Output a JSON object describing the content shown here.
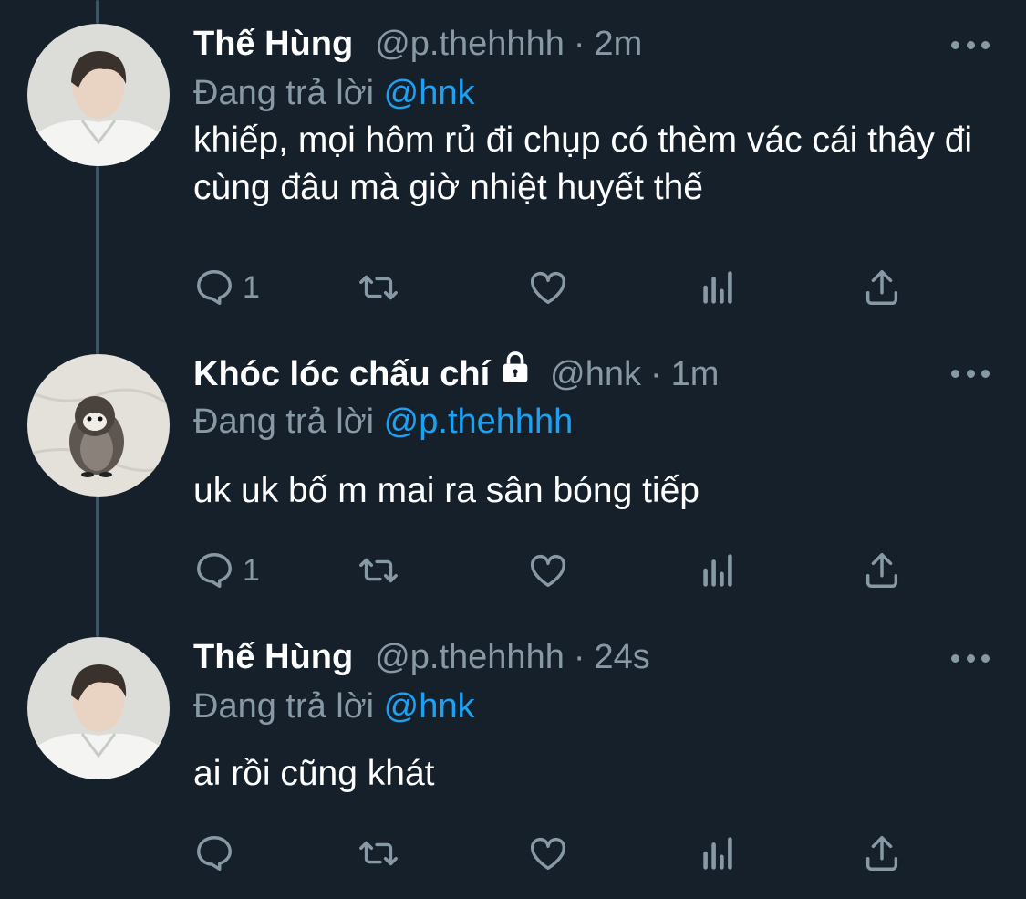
{
  "colors": {
    "background": "#15202b",
    "secondary_text": "#8899a6",
    "mention": "#1da1f2",
    "thread_line": "#3d5466"
  },
  "tweets": [
    {
      "name": "Thế Hùng",
      "handle": "@p.thehhhh",
      "separator": "·",
      "time": "2m",
      "reply_prefix": "Đang trả lời",
      "reply_to": "@hnk",
      "text": "khiếp, mọi hôm rủ đi chụp có thèm vác cái thây đi cùng đâu mà giờ nhiệt huyết thế",
      "reply_count": "1",
      "locked": false,
      "avatar_icon": "person-avatar"
    },
    {
      "name": "Khóc lóc chấu chí",
      "handle": "@hnk",
      "separator": "·",
      "time": "1m",
      "reply_prefix": "Đang trả lời",
      "reply_to": "@p.thehhhh",
      "text": "uk uk bố m mai ra sân bóng tiếp",
      "reply_count": "1",
      "locked": true,
      "avatar_icon": "penguin-plush-avatar"
    },
    {
      "name": "Thế Hùng",
      "handle": "@p.thehhhh",
      "separator": "·",
      "time": "24s",
      "reply_prefix": "Đang trả lời",
      "reply_to": "@hnk",
      "text": "ai rồi cũng khát",
      "reply_count": "",
      "locked": false,
      "avatar_icon": "person-avatar"
    }
  ],
  "action_icons": [
    "reply-icon",
    "retweet-icon",
    "like-icon",
    "analytics-icon",
    "share-icon"
  ]
}
